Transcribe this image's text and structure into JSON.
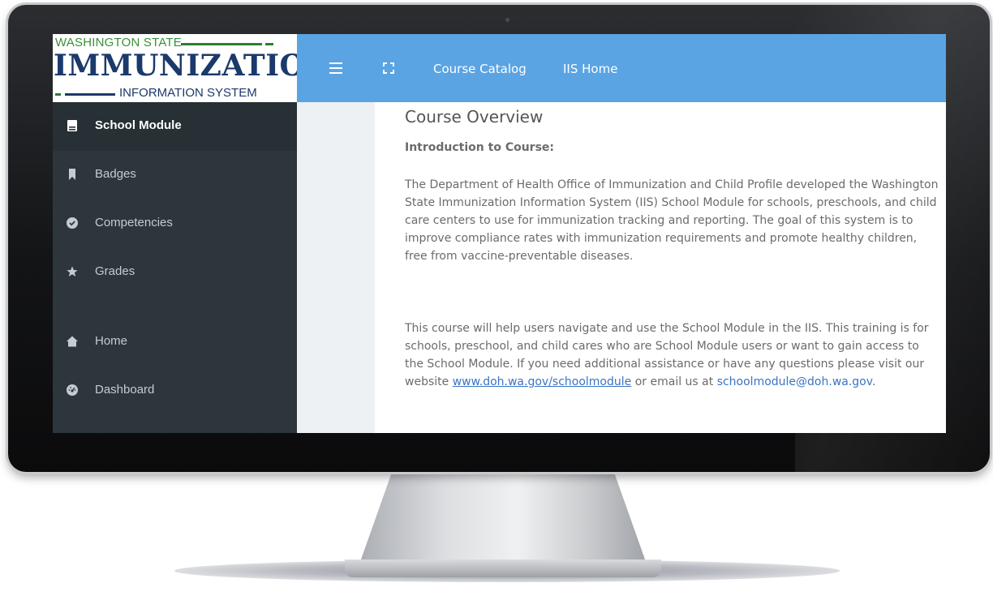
{
  "logo": {
    "line1": "WASHINGTON STATE",
    "line2": "IMMUNIZATION",
    "line3": "INFORMATION SYSTEM"
  },
  "topbar": {
    "menu_icon": "hamburger-menu-icon",
    "fullscreen_icon": "fullscreen-icon",
    "links": [
      "Course Catalog",
      "IIS Home"
    ],
    "color": "#5aa4e3"
  },
  "sidebar": {
    "items": [
      {
        "label": "School Module",
        "icon": "book-icon",
        "active": true
      },
      {
        "label": "Badges",
        "icon": "bookmark-icon"
      },
      {
        "label": "Competencies",
        "icon": "check-circle-icon"
      },
      {
        "label": "Grades",
        "icon": "star-icon"
      },
      {
        "label": "Home",
        "icon": "home-icon"
      },
      {
        "label": "Dashboard",
        "icon": "dashboard-gauge-icon"
      }
    ],
    "background": "#2c363c"
  },
  "content": {
    "title": "Course Overview",
    "intro_heading": "Introduction to Course:",
    "paragraph1": "The Department of Health Office of Immunization and Child Profile developed the Washington State Immunization Information System (IIS) School Module for schools, preschools, and child care centers to use for immunization tracking and reporting. The goal of this system is to improve compliance rates with immunization requirements and promote healthy children, free from vaccine-preventable diseases.",
    "paragraph2_start": "This course will help users navigate and use the School Module in the IIS. This training is for schools, preschool, and child cares who are School Module users or want to gain access to the School Module. If you need additional assistance or have any questions please visit our website ",
    "website_link": "www.doh.wa.gov/schoolmodule",
    "paragraph2_mid": " or email us at ",
    "email_link": "schoolmodule@doh.wa.gov",
    "paragraph2_end": "."
  }
}
